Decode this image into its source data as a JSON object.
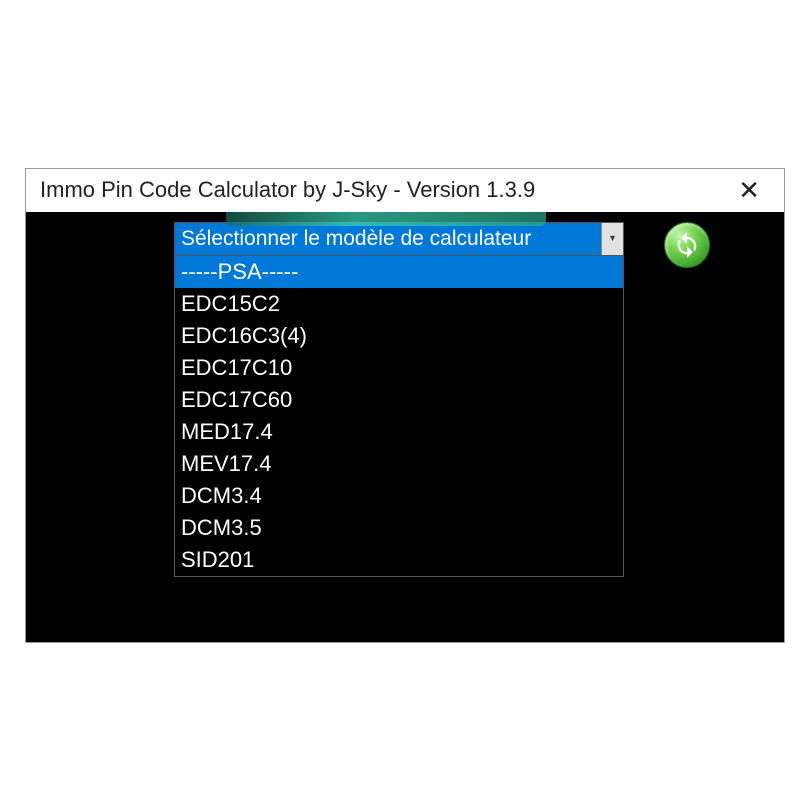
{
  "titlebar": {
    "title": "Immo Pin Code Calculator by J-Sky  -  Version 1.3.9"
  },
  "dropdown": {
    "selected": "Sélectionner le modèle de calculateur",
    "items": [
      {
        "label": "-----PSA-----",
        "highlighted": true
      },
      {
        "label": "EDC15C2",
        "highlighted": false
      },
      {
        "label": "EDC16C3(4)",
        "highlighted": false
      },
      {
        "label": "EDC17C10",
        "highlighted": false
      },
      {
        "label": "EDC17C60",
        "highlighted": false
      },
      {
        "label": "MED17.4",
        "highlighted": false
      },
      {
        "label": "MEV17.4",
        "highlighted": false
      },
      {
        "label": "DCM3.4",
        "highlighted": false
      },
      {
        "label": "DCM3.5",
        "highlighted": false
      },
      {
        "label": "SID201",
        "highlighted": false
      }
    ]
  }
}
